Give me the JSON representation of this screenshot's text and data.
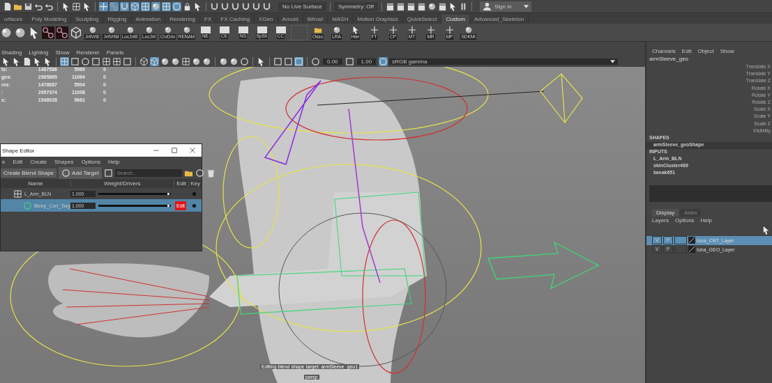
{
  "status_line": {
    "surface_field": "No Live Surface",
    "symmetry": "Symmetry: Off",
    "sign_in": "Sign In"
  },
  "shelf_tabs": [
    {
      "label": "urfaces",
      "selected": false
    },
    {
      "label": "Poly Modeling",
      "selected": false
    },
    {
      "label": "Sculpting",
      "selected": false
    },
    {
      "label": "Rigging",
      "selected": false
    },
    {
      "label": "Animation",
      "selected": false
    },
    {
      "label": "Rendering",
      "selected": false
    },
    {
      "label": "FX",
      "selected": false
    },
    {
      "label": "FX Caching",
      "selected": false
    },
    {
      "label": "XGen",
      "selected": false
    },
    {
      "label": "Arnold",
      "selected": false
    },
    {
      "label": "Bifrost",
      "selected": false
    },
    {
      "label": "MASH",
      "selected": false
    },
    {
      "label": "Motion Graphics",
      "selected": false
    },
    {
      "label": "QuickSelect",
      "selected": false
    },
    {
      "label": "Custom",
      "selected": true
    },
    {
      "label": "Advanced_Skeleton",
      "selected": false
    }
  ],
  "shelf_buttons": [
    {
      "label": "JntVrtE",
      "kind": "python"
    },
    {
      "label": "JntVrtM",
      "kind": "python"
    },
    {
      "label": "LocJntE",
      "kind": "python"
    },
    {
      "label": "LocJnt",
      "kind": "python"
    },
    {
      "label": "CrvDriv",
      "kind": "python"
    },
    {
      "label": "RENAM",
      "kind": "python"
    },
    {
      "label": "NE",
      "kind": "window"
    },
    {
      "label": "CE",
      "kind": "window"
    },
    {
      "label": "NS",
      "kind": "window"
    },
    {
      "label": "SpSh",
      "kind": "window"
    },
    {
      "label": "CC",
      "kind": "window"
    },
    {
      "label": "Osso",
      "kind": "folder"
    },
    {
      "label": "LRA",
      "kind": "eye"
    },
    {
      "label": "Hier",
      "kind": "cursor"
    },
    {
      "label": "FT",
      "kind": "axes"
    },
    {
      "label": "CP",
      "kind": "axes"
    },
    {
      "label": "MT",
      "kind": "axes"
    },
    {
      "label": "MR",
      "kind": "axes"
    },
    {
      "label": "MP",
      "kind": "axes"
    },
    {
      "label": "SDKMi",
      "kind": "python"
    }
  ],
  "viewport": {
    "menu": [
      "Shading",
      "Lighting",
      "Show",
      "Renderer",
      "Panels"
    ],
    "exposure": "0.00",
    "gamma": "1.00",
    "color_space": "sRGB gamma",
    "stats": [
      {
        "label": "ts:",
        "values": [
          "1487586",
          "5560",
          "0"
        ]
      },
      {
        "label": "ges:",
        "values": [
          "2965865",
          "11064",
          "0"
        ]
      },
      {
        "label": "res:",
        "values": [
          "1478687",
          "5504",
          "0"
        ]
      },
      {
        "label": ":",
        "values": [
          "2957374",
          "11008",
          "0"
        ]
      },
      {
        "label": "s:",
        "values": [
          "1548928",
          "5661",
          "0"
        ]
      }
    ],
    "hud_message": "Editing blend shape target: armSleeve_geo1",
    "camera": "persp"
  },
  "shape_editor": {
    "title": "Shape Editor",
    "menu": [
      "e",
      "Edit",
      "Create",
      "Shapes",
      "Options",
      "Help"
    ],
    "buttons": [
      "Create Blend Shape",
      "Add Target"
    ],
    "search": {
      "placeholder": "Search..."
    },
    "columns": [
      "Name",
      "Weight/Drivers",
      "Edit",
      "Key"
    ],
    "rows": [
      {
        "kind": "blendshape",
        "name": "L_Arm_BLN",
        "weight": "1.000",
        "level": 0.98,
        "selected": false,
        "children": [
          {
            "kind": "target",
            "name": "Bicep_Curl_Targ",
            "weight": "1.000",
            "level": 0.98,
            "selected": true,
            "edit": "Edit",
            "editing": true
          }
        ]
      }
    ]
  },
  "channel_box": {
    "menu": [
      "Channels",
      "Edit",
      "Object",
      "Show"
    ],
    "object": "armSleeve_geo",
    "attributes": [
      "Translate X",
      "Translate Y",
      "Translate Z",
      "Rotate X",
      "Rotate Y",
      "Rotate Z",
      "Scale X",
      "Scale Y",
      "Scale Z",
      "Visibility"
    ],
    "shapes_header": "SHAPES",
    "shapes": [
      {
        "name": "armSleeve_geoShape",
        "selected": true
      }
    ],
    "inputs_header": "INPUTS",
    "inputs": [
      "L_Arm_BLN",
      "skinCluster489",
      "tweak651"
    ]
  },
  "layer_editor": {
    "tabs": [
      {
        "label": "Display",
        "selected": true
      },
      {
        "label": "Anim",
        "selected": false
      }
    ],
    "menu": [
      "Layers",
      "Options",
      "Help"
    ],
    "layers": [
      {
        "visible": "V",
        "playback": "P",
        "name": "Iona_CNT_Layer",
        "selected": true
      },
      {
        "visible": "V",
        "playback": "P",
        "name": "Iona_GEO_Layer",
        "selected": false
      }
    ]
  }
}
